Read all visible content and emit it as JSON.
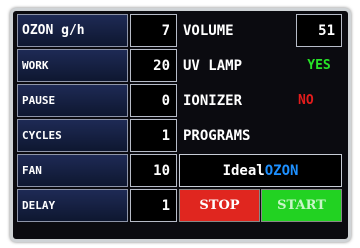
{
  "params": {
    "ozon": {
      "label": "OZON g/h",
      "value": "7"
    },
    "work": {
      "label": "WORK",
      "value": "20"
    },
    "pause": {
      "label": "PAUSE",
      "value": "0"
    },
    "cycles": {
      "label": "CYCLES",
      "value": "1"
    },
    "fan": {
      "label": "FAN",
      "value": "10"
    },
    "delay": {
      "label": "DELAY",
      "value": "1"
    }
  },
  "right": {
    "volume": {
      "label": "VOLUME",
      "value": "51"
    },
    "uv_lamp": {
      "label": "UV LAMP",
      "status": "YES"
    },
    "ionizer": {
      "label": "IONIZER",
      "status": "NO"
    },
    "programs": {
      "label": "PROGRAMS"
    },
    "brand": {
      "part1": "Ideal",
      "part2": "OZON"
    }
  },
  "buttons": {
    "stop": "STOP",
    "start": "START"
  },
  "colors": {
    "label_bg": "#16224a",
    "status_yes": "#27e427",
    "status_no": "#e21c1c",
    "brand_blue": "#1e90ff",
    "stop_bg": "#e0261f",
    "start_bg": "#22d222"
  }
}
